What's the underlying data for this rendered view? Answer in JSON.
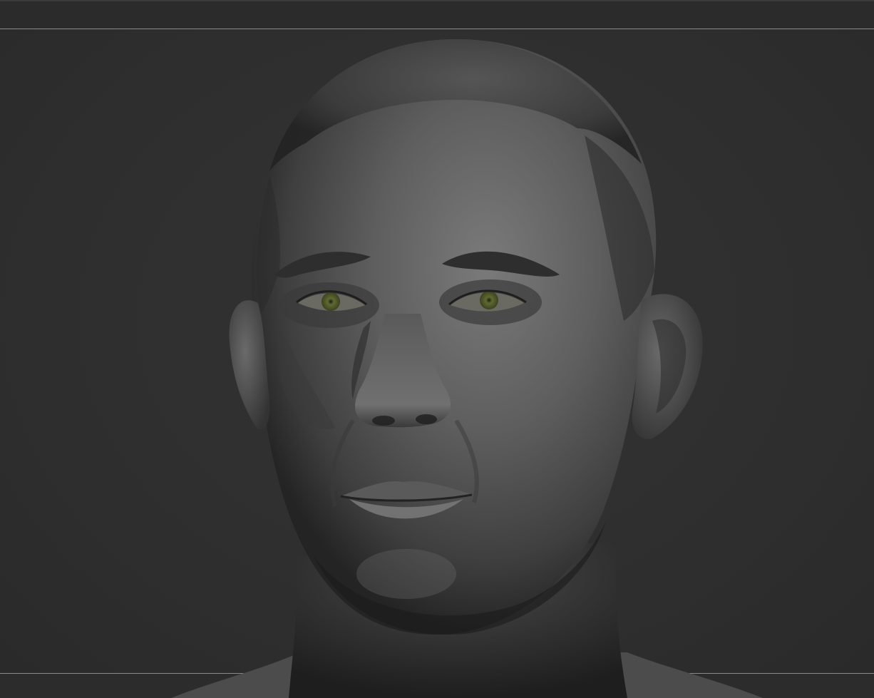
{
  "viewport": {
    "content": "3d-sculpt-head",
    "background_color": "#2e2e2e",
    "guide_line_color": "#8a8a8a",
    "material_color": "#6e6e6e",
    "iris_color": "#6f7a3c"
  }
}
